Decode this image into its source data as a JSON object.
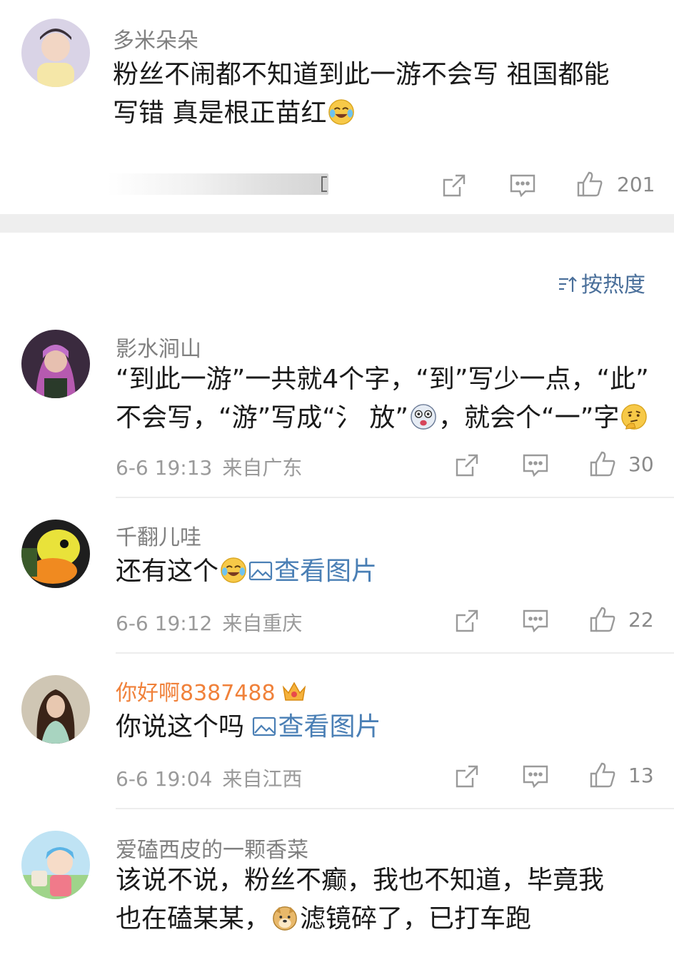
{
  "post": {
    "username": "多米朵朵",
    "text_line1": "粉丝不闹都不知道到此一游不会写  祖国都能",
    "text_line2": "写错  真是根正苗红",
    "emoji": "laugh-cry-emoji",
    "like_count": "201"
  },
  "sort": {
    "label": "按热度",
    "icon": "sort-icon"
  },
  "comments": [
    {
      "username": "影水涧山",
      "line1": "“到此一游”一共就4个字，“到”写少一点，“此”",
      "line2a": "不会写，“游”写成“氵 放”",
      "line2b": "，就会个“一”字",
      "time": "6-6 19:13",
      "location": "来自广东",
      "like_count": "30"
    },
    {
      "username": "千翻儿哇",
      "text": "还有这个",
      "pic_label": "查看图片",
      "time": "6-6 19:12",
      "location": "来自重庆",
      "like_count": "22"
    },
    {
      "username": "你好啊8387488",
      "text": "你说这个吗 ",
      "pic_label": "查看图片",
      "time": "6-6 19:04",
      "location": "来自江西",
      "like_count": "13"
    },
    {
      "username": "爱磕西皮的一颗香菜",
      "line1": "该说不说，粉丝不癫，我也不知道，毕竟我",
      "line2a": "也在磕某某，",
      "line2b": "滤镜碎了，已打车跑"
    }
  ],
  "colors": {
    "username": "#808080",
    "vip_username": "#f0813a",
    "link": "#4a7fb5",
    "meta": "#9a9a9a"
  }
}
